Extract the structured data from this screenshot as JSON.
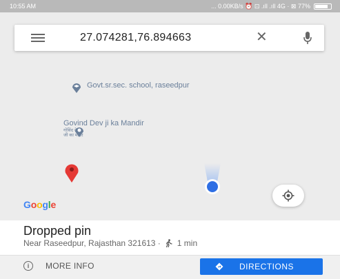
{
  "status_bar": {
    "time": "10:55 AM",
    "indicators": "... 0.00KB/s ⏰ ⊡ .ıll .ıll 4G · ⊠ 77%"
  },
  "search": {
    "query": "27.074281,76.894663"
  },
  "map": {
    "school_label": "Govt.sr.sec. school, raseedpur",
    "temple_label": "Govind Dev ji ka Mandir",
    "temple_sublabel_1": "गोविंद देव",
    "temple_sublabel_2": "जी का मंदिर",
    "google_logo": [
      "G",
      "o",
      "o",
      "g",
      "l",
      "e"
    ],
    "google_colors": [
      "#4285f4",
      "#ea4335",
      "#fbbc05",
      "#4285f4",
      "#34a853",
      "#ea4335"
    ]
  },
  "place": {
    "title": "Dropped pin",
    "address": "Near Raseedpur, Rajasthan 321613 ·",
    "walk_time": "1 min"
  },
  "actions": {
    "more_info_label": "MORE INFO",
    "directions_label": "DIRECTIONS"
  },
  "icons": [
    "hamburger-icon",
    "close-icon",
    "mic-icon",
    "school-pin-icon",
    "temple-pin-icon",
    "dropped-pin-icon",
    "my-location-dot",
    "my-location-icon",
    "walk-icon",
    "info-icon",
    "directions-icon"
  ],
  "colors": {
    "accent": "#1a73e8",
    "pin": "#e53935",
    "poi": "#6a7f9a"
  }
}
